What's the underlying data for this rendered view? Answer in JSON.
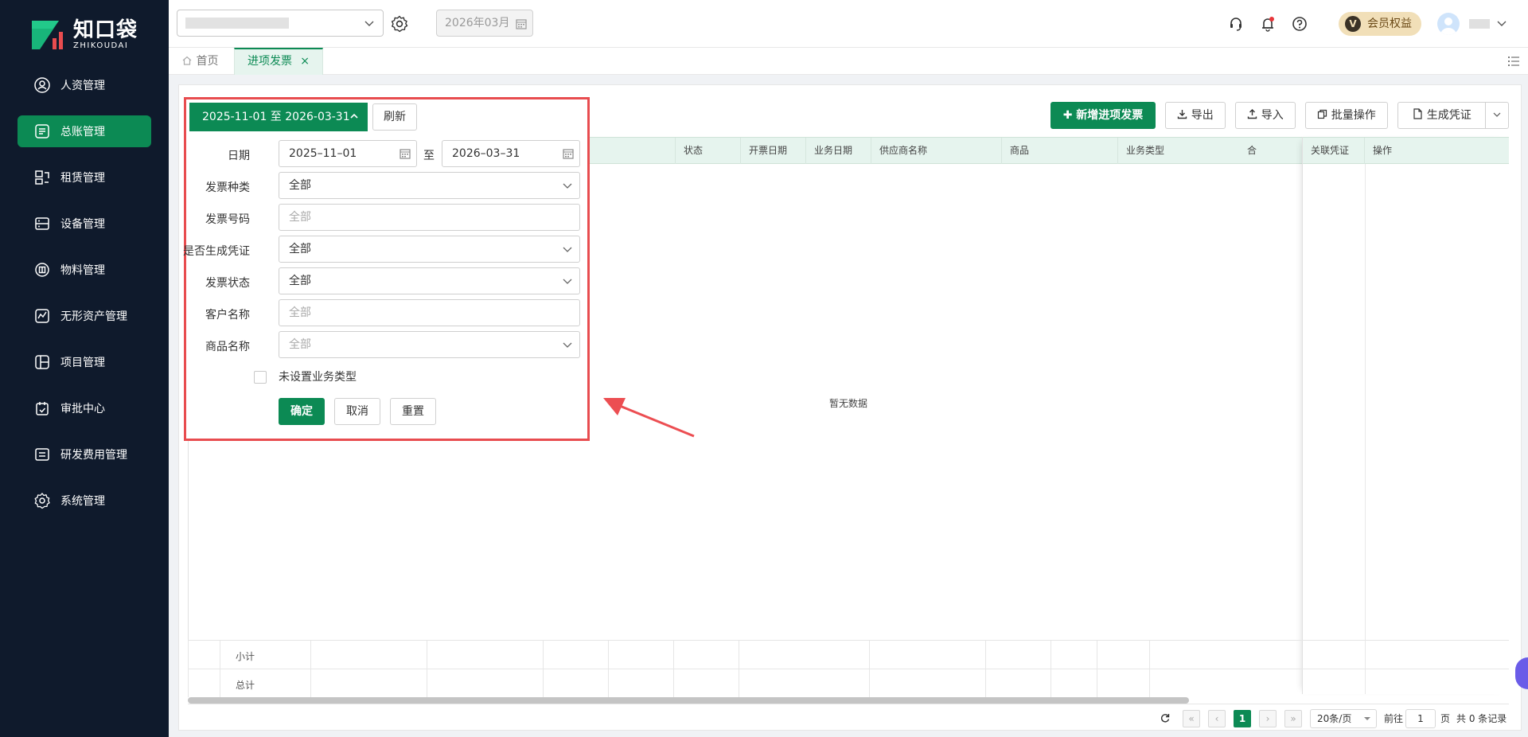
{
  "brand": {
    "name_cn": "知口袋",
    "name_en": "ZHIKOUDAI",
    "accent": "#0c8a54"
  },
  "sidebar": {
    "items": [
      {
        "label": "人资管理",
        "icon": "person-icon",
        "active": false
      },
      {
        "label": "总账管理",
        "icon": "ledger-icon",
        "active": true
      },
      {
        "label": "租赁管理",
        "icon": "lease-icon",
        "active": false
      },
      {
        "label": "设备管理",
        "icon": "device-icon",
        "active": false
      },
      {
        "label": "物料管理",
        "icon": "material-icon",
        "active": false
      },
      {
        "label": "无形资产管理",
        "icon": "intangible-asset-icon",
        "active": false
      },
      {
        "label": "项目管理",
        "icon": "project-icon",
        "active": false
      },
      {
        "label": "审批中心",
        "icon": "approval-icon",
        "active": false
      },
      {
        "label": "研发费用管理",
        "icon": "rd-expense-icon",
        "active": false
      },
      {
        "label": "系统管理",
        "icon": "settings-icon",
        "active": false
      }
    ]
  },
  "topbar": {
    "period": "2026年03月",
    "vip_badge": "V",
    "vip_label": "会员权益",
    "icons": [
      "headset-icon",
      "bell-icon",
      "help-icon"
    ]
  },
  "tabs": {
    "home": "首页",
    "active": "进项发票",
    "close": "×"
  },
  "toolbar": {
    "add": "新增进项发票",
    "export": "导出",
    "import": "导入",
    "batch": "批量操作",
    "voucher": "生成凭证"
  },
  "table": {
    "columns": [
      "状态",
      "开票日期",
      "业务日期",
      "供应商名称",
      "商品",
      "业务类型",
      "合",
      "关联凭证",
      "操作"
    ],
    "empty": "暂无数据",
    "subtotal": "小计",
    "total": "总计"
  },
  "pagination": {
    "current": "1",
    "page_size": "20条/页",
    "goto_prefix": "前往",
    "goto_value": "1",
    "goto_suffix": "页",
    "summary": "共 0 条记录"
  },
  "filter": {
    "range_label": "2025-11-01 至 2026-03-31",
    "refresh": "刷新",
    "date_label": "日期",
    "date_from": "2025–11–01",
    "date_sep": "至",
    "date_to": "2026–03–31",
    "invoice_type_label": "发票种类",
    "invoice_type_value": "全部",
    "invoice_no_label": "发票号码",
    "invoice_no_placeholder": "全部",
    "voucher_generated_label": "是否生成凭证",
    "voucher_generated_value": "全部",
    "invoice_status_label": "发票状态",
    "invoice_status_value": "全部",
    "customer_label": "客户名称",
    "customer_placeholder": "全部",
    "product_label": "商品名称",
    "product_placeholder": "全部",
    "unset_business_type": "未设置业务类型",
    "confirm": "确定",
    "cancel": "取消",
    "reset": "重置"
  }
}
